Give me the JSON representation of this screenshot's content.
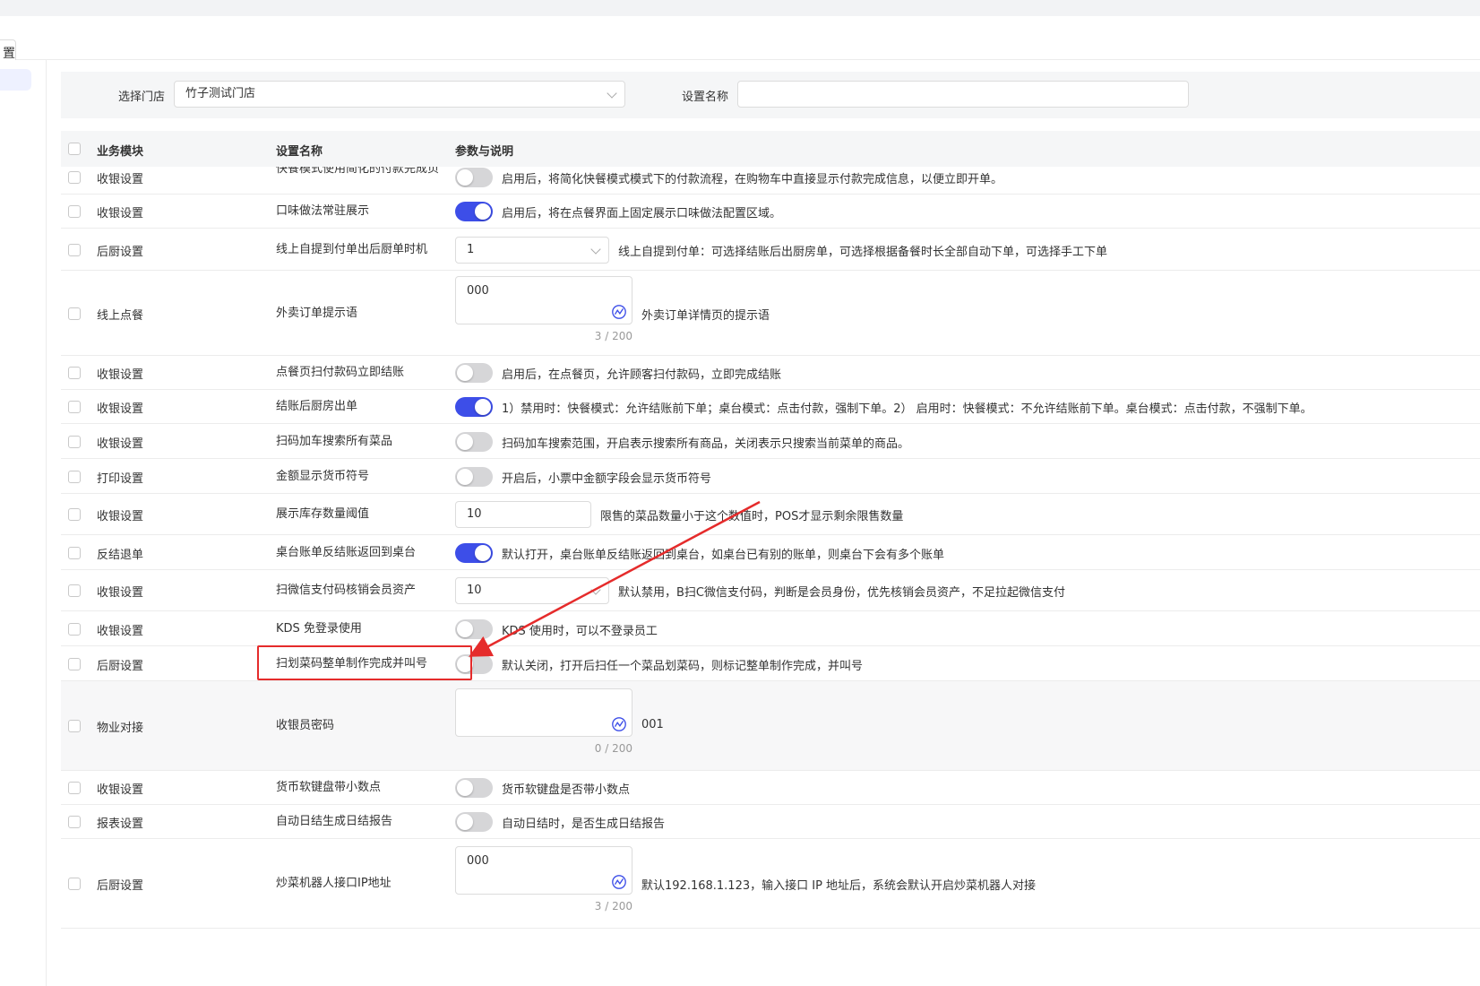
{
  "tab": {
    "label": "置"
  },
  "filter": {
    "store_label": "选择门店",
    "store_value": "竹子测试门店",
    "name_label": "设置名称",
    "name_value": ""
  },
  "table": {
    "headers": {
      "module": "业务模块",
      "name": "设置名称",
      "param": "参数与说明"
    },
    "rows": [
      {
        "module": "收银设置",
        "name": "快餐模式使用简化的付款完成页",
        "control": "toggle",
        "on": false,
        "desc": "启用后，将简化快餐模式模式下的付款流程，在购物车中直接显示付款完成信息，以便立即开单。"
      },
      {
        "module": "收银设置",
        "name": "口味做法常驻展示",
        "control": "toggle",
        "on": true,
        "desc": "启用后，将在点餐界面上固定展示口味做法配置区域。"
      },
      {
        "module": "后厨设置",
        "name": "线上自提到付单出后厨单时机",
        "control": "select",
        "value": "1",
        "desc": "线上自提到付单：可选择结账后出厨房单，可选择根据备餐时长全部自动下单，可选择手工下单"
      },
      {
        "module": "线上点餐",
        "name": "外卖订单提示语",
        "control": "textarea",
        "value": "000",
        "counter": "3 / 200",
        "desc": "外卖订单详情页的提示语"
      },
      {
        "module": "收银设置",
        "name": "点餐页扫付款码立即结账",
        "control": "toggle",
        "on": false,
        "desc": "启用后，在点餐页，允许顾客扫付款码，立即完成结账"
      },
      {
        "module": "收银设置",
        "name": "结账后厨房出单",
        "control": "toggle",
        "on": true,
        "desc": "1）禁用时：快餐模式：允许结账前下单；桌台模式：点击付款，强制下单。2） 启用时：快餐模式：不允许结账前下单。桌台模式：点击付款，不强制下单。"
      },
      {
        "module": "收银设置",
        "name": "扫码加车搜索所有菜品",
        "control": "toggle",
        "on": false,
        "desc": "扫码加车搜索范围，开启表示搜索所有商品，关闭表示只搜索当前菜单的商品。"
      },
      {
        "module": "打印设置",
        "name": "金额显示货币符号",
        "control": "toggle",
        "on": false,
        "desc": "开启后，小票中金额字段会显示货币符号"
      },
      {
        "module": "收银设置",
        "name": "展示库存数量阈值",
        "control": "number",
        "value": "10",
        "desc": "限售的菜品数量小于这个数值时，POS才显示剩余限售数量"
      },
      {
        "module": "反结退单",
        "name": "桌台账单反结账返回到桌台",
        "control": "toggle",
        "on": true,
        "desc": "默认打开，桌台账单反结账返回到桌台，如桌台已有别的账单，则桌台下会有多个账单"
      },
      {
        "module": "收银设置",
        "name": "扫微信支付码核销会员资产",
        "control": "select",
        "value": "10",
        "desc": "默认禁用，B扫C微信支付码，判断是会员身份，优先核销会员资产，不足拉起微信支付"
      },
      {
        "module": "收银设置",
        "name": "KDS 免登录使用",
        "control": "toggle",
        "on": false,
        "desc": "KDS 使用时，可以不登录员工"
      },
      {
        "module": "后厨设置",
        "name": "扫划菜码整单制作完成并叫号",
        "control": "toggle",
        "on": false,
        "desc": "默认关闭，打开后扫任一个菜品划菜码，则标记整单制作完成，并叫号"
      },
      {
        "module": "物业对接",
        "name": "收银员密码",
        "control": "textarea",
        "value": "",
        "counter": "0 / 200",
        "desc": "001"
      },
      {
        "module": "收银设置",
        "name": "货币软键盘带小数点",
        "control": "toggle",
        "on": false,
        "desc": "货币软键盘是否带小数点"
      },
      {
        "module": "报表设置",
        "name": "自动日结生成日结报告",
        "control": "toggle",
        "on": false,
        "desc": "自动日结时，是否生成日结报告"
      },
      {
        "module": "后厨设置",
        "name": "炒菜机器人接口IP地址",
        "control": "textarea",
        "value": "000",
        "counter": "3 / 200",
        "desc": "默认192.168.1.123，输入接口 IP 地址后，系统会默认开启炒菜机器人对接"
      }
    ]
  },
  "colors": {
    "accent": "#3d4ee8",
    "highlight": "#e52b2b",
    "toggle_off": "#d6d6d8"
  }
}
